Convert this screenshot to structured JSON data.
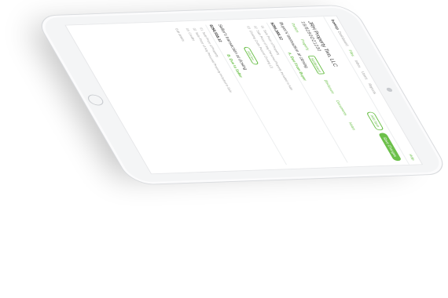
{
  "app": {
    "brand": "bowsp",
    "help": "Help"
  },
  "nav": [
    "Dashboard",
    "Files",
    "Inbox",
    "Users",
    "Reports"
  ],
  "nav_active": "Files",
  "buttons": {
    "secondary": "Add Item",
    "primary": "Save Changes"
  },
  "header": {
    "title": "JRH Property Two, LLC",
    "file_number": "16/8290O21230"
  },
  "tabs": [
    "Parties",
    "Property",
    "Settlement",
    "Disclosure",
    "Documents",
    "Notes"
  ],
  "active_tab": "Settlement",
  "buyer": {
    "heading": "Buyer's transaction at closing",
    "total": "$256,555.12",
    "section": "A. Due From Buyer",
    "items": [
      {
        "num": "01",
        "label": "Sale Price of Property"
      },
      {
        "num": "02",
        "label": "Sale Price of Any Personal Property Included in Sale"
      },
      {
        "num": "03",
        "label": "Closing Costs Paid at Closing (J)"
      }
    ],
    "add_label": "Add line"
  },
  "seller": {
    "heading": "Seller's transaction at closing",
    "total": "$256,555.12",
    "section": "B. Due to Seller",
    "items": [
      {
        "num": "01",
        "label": "Sale Price of Property"
      },
      {
        "num": "02",
        "label": "Sale Price of Any Personal Property Included in Sale"
      },
      {
        "num": "03",
        "label": "Credits"
      }
    ],
    "link_label": "Edit details"
  }
}
